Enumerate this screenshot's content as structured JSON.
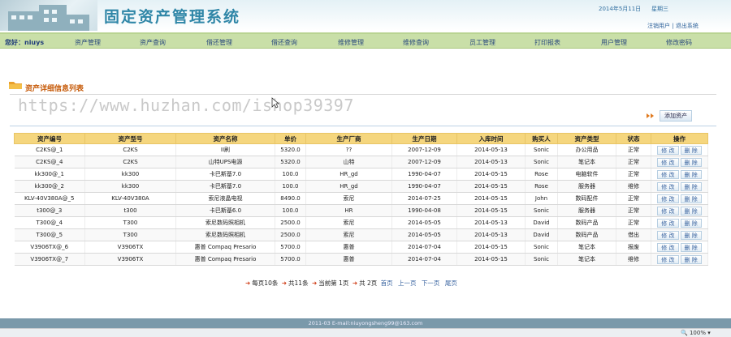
{
  "header": {
    "title": "固定资产管理系统",
    "date": "2014年5月11日",
    "weekday": "星期三",
    "links": [
      "注销用户",
      "退出系统"
    ]
  },
  "nav": {
    "greeting": "您好：niuys",
    "items": [
      "资产管理",
      "资产查询",
      "借还管理",
      "借还查询",
      "维修管理",
      "维修查询",
      "员工管理",
      "打印报表",
      "用户管理",
      "修改密码"
    ]
  },
  "section": {
    "title": "资产详细信息列表"
  },
  "watermark": "https://www.huzhan.com/ishop39397",
  "toolbar": {
    "add_label": "添加资产"
  },
  "table": {
    "headers": [
      "资产编号",
      "资产型号",
      "资产名称",
      "单价",
      "生产厂商",
      "生产日期",
      "入库时间",
      "购买人",
      "资产类型",
      "状态",
      "操作"
    ],
    "edit_label": "修 改",
    "delete_label": "删 除",
    "rows": [
      [
        "C2KS@_1",
        "C2KS",
        "II刷",
        "5320.0",
        "??",
        "2007-12-09",
        "2014-05-13",
        "Sonic",
        "办公用品",
        "正常"
      ],
      [
        "C2KS@_4",
        "C2KS",
        "山特UPS电源",
        "5320.0",
        "山特",
        "2007-12-09",
        "2014-05-13",
        "Sonic",
        "笔记本",
        "正常"
      ],
      [
        "kk300@_1",
        "kk300",
        "卡巴斯基7.0",
        "100.0",
        "HR_gd",
        "1990-04-07",
        "2014-05-15",
        "Rose",
        "电脑软件",
        "正常"
      ],
      [
        "kk300@_2",
        "kk300",
        "卡巴斯基7.0",
        "100.0",
        "HR_gd",
        "1990-04-07",
        "2014-05-15",
        "Rose",
        "服务器",
        "维修"
      ],
      [
        "KLV-40V380A@_5",
        "KLV-40V380A",
        "索尼液晶电视",
        "8490.0",
        "索尼",
        "2014-07-25",
        "2014-05-15",
        "John",
        "数码配件",
        "正常"
      ],
      [
        "t300@_3",
        "t300",
        "卡巴斯基6.0",
        "100.0",
        "HR",
        "1990-04-08",
        "2014-05-15",
        "Sonic",
        "服务器",
        "正常"
      ],
      [
        "T300@_4",
        "T300",
        "索尼数码照相机",
        "2500.0",
        "索尼",
        "2014-05-05",
        "2014-05-13",
        "David",
        "数码产品",
        "正常"
      ],
      [
        "T300@_5",
        "T300",
        "索尼数码照相机",
        "2500.0",
        "索尼",
        "2014-05-05",
        "2014-05-13",
        "David",
        "数码产品",
        "借出"
      ],
      [
        "V3906TX@_6",
        "V3906TX",
        "惠普 Compaq Presario",
        "5700.0",
        "惠普",
        "2014-07-04",
        "2014-05-15",
        "Sonic",
        "笔记本",
        "报废"
      ],
      [
        "V3906TX@_7",
        "V3906TX",
        "惠普 Compaq Presario",
        "5700.0",
        "惠普",
        "2014-07-04",
        "2014-05-15",
        "Sonic",
        "笔记本",
        "维修"
      ]
    ]
  },
  "pager": {
    "per_page": "每页10条",
    "total": "共11条",
    "current": "当前第 1页",
    "pages": "共 2页",
    "first": "首页",
    "prev": "上一页",
    "next": "下一页",
    "last": "尾页"
  },
  "footer": {
    "text": "2011-03 E-mail:niuyongsheng99@163.com"
  },
  "statusbar": {
    "zoom": "100%"
  },
  "colors": {
    "nav_bg": "#c9dfa8",
    "header_row": "#f5d67e",
    "title_blue": "#2f86a7",
    "section_orange": "#c65a09",
    "footer_bg": "#7a99aa"
  }
}
